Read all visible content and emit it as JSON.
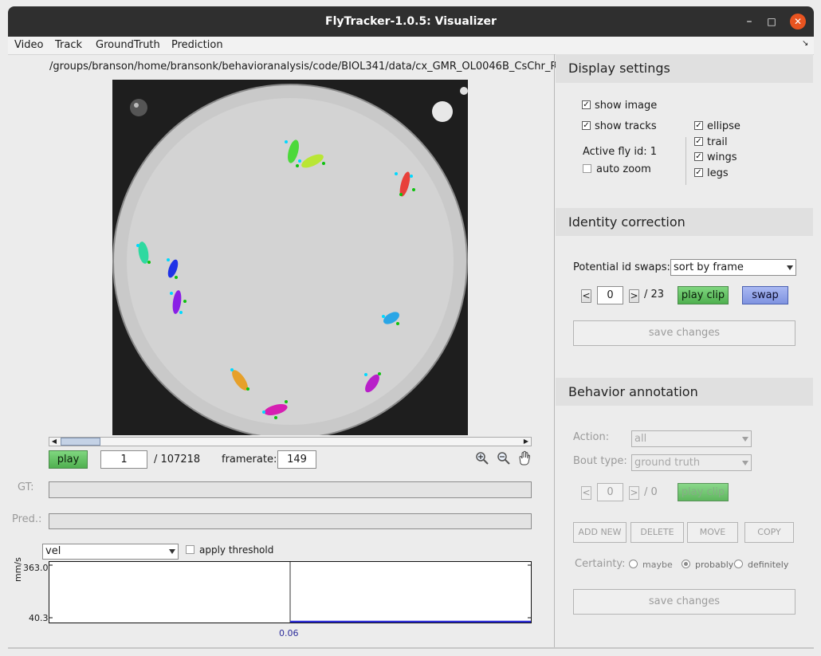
{
  "window": {
    "title": "FlyTracker-1.0.5: Visualizer",
    "controls": {
      "minimize": "–",
      "maximize": "□",
      "close": "✕"
    }
  },
  "menu": [
    "Video",
    "Track",
    "GroundTruth",
    "Prediction"
  ],
  "menu_corner": "↘",
  "video": {
    "path": "/groups/branson/home/bransonk/behavioranalysis/code/BIOL341/data/cx_GMR_OL0046B_CsChr_R",
    "play_label": "play",
    "frame_value": "1",
    "frame_total": "/  107218",
    "framerate_label": "framerate:",
    "framerate_value": "149",
    "tool_icons": [
      "zoom-in-icon",
      "zoom-out-icon",
      "pan-hand-icon"
    ],
    "scroll_left": "◀",
    "scroll_right": "▶"
  },
  "tracks": {
    "gt_label": "GT:",
    "pred_label": "Pred.:"
  },
  "plot": {
    "feature_selected": "vel",
    "apply_threshold_label": "apply threshold",
    "apply_threshold_checked": false,
    "y_max": "363.0",
    "y_min": "40.3",
    "y_label": "mm/s",
    "x_marker": "0.06",
    "line_color": "#2b2bd6"
  },
  "display_settings": {
    "title": "Display settings",
    "show_image": "show image",
    "show_tracks": "show tracks",
    "active_fly": "Active fly id: 1",
    "auto_zoom": "auto zoom",
    "ellipse": "ellipse",
    "trail": "trail",
    "wings": "wings",
    "legs": "legs",
    "checked": "✓"
  },
  "identity": {
    "title": "Identity correction",
    "swaps_label": "Potential id swaps:",
    "sort_value": "sort by frame",
    "prev": "<",
    "next": ">",
    "index": "0",
    "total": "/  23",
    "play_clip": "play clip",
    "swap": "swap",
    "save_changes": "save changes"
  },
  "behavior": {
    "title": "Behavior annotation",
    "action_label": "Action:",
    "action_value": "all",
    "bout_label": "Bout type:",
    "bout_value": "ground truth",
    "prev": "<",
    "next": ">",
    "index": "0",
    "total": "/  0",
    "play_clip": "play clip",
    "add_new": "ADD NEW",
    "delete": "DELETE",
    "move": "MOVE",
    "copy": "COPY",
    "certainty_label": "Certainty:",
    "maybe": "maybe",
    "probably": "probably",
    "definitely": "definitely",
    "save_changes": "save changes"
  },
  "colors": {
    "title_bar": "#2f2f2f",
    "close_button": "#e95420",
    "play_green": "#5fbf5f",
    "swap_blue": "#8aa0ea"
  }
}
